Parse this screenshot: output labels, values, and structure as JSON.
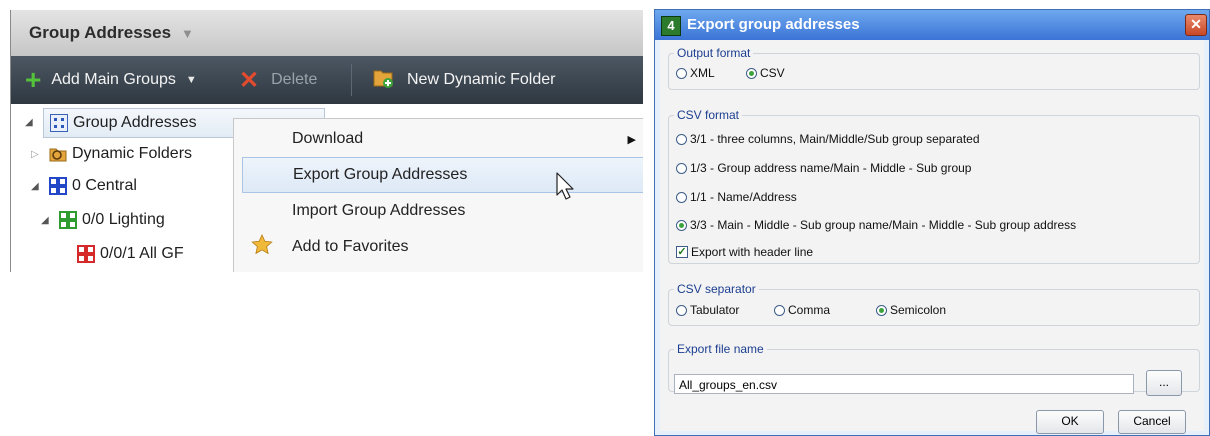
{
  "left_panel": {
    "title": "Group Addresses",
    "toolbar": {
      "add_main_groups": "Add Main Groups",
      "delete": "Delete",
      "new_dynamic_folder": "New Dynamic Folder"
    },
    "tree": {
      "root": "Group Addresses",
      "dynamic_folders": "Dynamic Folders",
      "central": "0 Central",
      "lighting": "0/0 Lighting",
      "all_gf": "0/0/1 All GF"
    },
    "context_menu": {
      "download": "Download",
      "export": "Export Group Addresses",
      "import": "Import Group Addresses",
      "favorites": "Add to Favorites"
    }
  },
  "dialog": {
    "title": "Export group addresses",
    "output_format": {
      "legend": "Output format",
      "options": [
        "XML",
        "CSV"
      ],
      "selected": "CSV"
    },
    "csv_format": {
      "legend": "CSV format",
      "options": [
        "3/1 - three columns, Main/Middle/Sub group separated",
        "1/3 - Group address name/Main - Middle - Sub group",
        "1/1 - Name/Address",
        "3/3 - Main - Middle - Sub group name/Main - Middle - Sub group address"
      ],
      "selected_index": 3,
      "header_line_label": "Export with header line",
      "header_line_checked": true
    },
    "csv_separator": {
      "legend": "CSV separator",
      "options": [
        "Tabulator",
        "Comma",
        "Semicolon"
      ],
      "selected": "Semicolon"
    },
    "export_file": {
      "legend": "Export file name",
      "value": "All_groups_en.csv",
      "browse_label": "..."
    },
    "buttons": {
      "ok": "OK",
      "cancel": "Cancel"
    }
  }
}
